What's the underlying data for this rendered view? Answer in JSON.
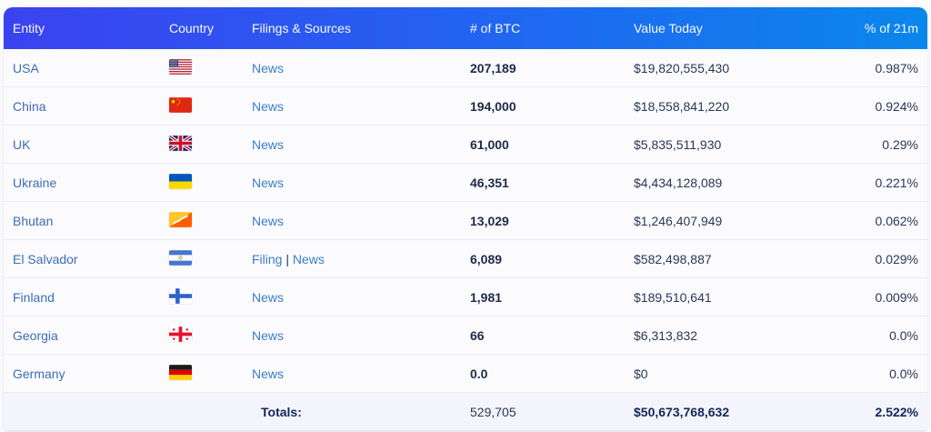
{
  "table": {
    "columns": [
      "Entity",
      "Country",
      "Filings & Sources",
      "# of BTC",
      "Value Today",
      "% of 21m"
    ],
    "rows": [
      {
        "entity": "USA",
        "flag": "usa",
        "sources": [
          "News"
        ],
        "btc": "207,189",
        "value": "$19,820,555,430",
        "pct": "0.987%"
      },
      {
        "entity": "China",
        "flag": "china",
        "sources": [
          "News"
        ],
        "btc": "194,000",
        "value": "$18,558,841,220",
        "pct": "0.924%"
      },
      {
        "entity": "UK",
        "flag": "uk",
        "sources": [
          "News"
        ],
        "btc": "61,000",
        "value": "$5,835,511,930",
        "pct": "0.29%"
      },
      {
        "entity": "Ukraine",
        "flag": "ukraine",
        "sources": [
          "News"
        ],
        "btc": "46,351",
        "value": "$4,434,128,089",
        "pct": "0.221%"
      },
      {
        "entity": "Bhutan",
        "flag": "bhutan",
        "sources": [
          "News"
        ],
        "btc": "13,029",
        "value": "$1,246,407,949",
        "pct": "0.062%"
      },
      {
        "entity": "El Salvador",
        "flag": "el-salvador",
        "sources": [
          "Filing",
          "News"
        ],
        "btc": "6,089",
        "value": "$582,498,887",
        "pct": "0.029%"
      },
      {
        "entity": "Finland",
        "flag": "finland",
        "sources": [
          "News"
        ],
        "btc": "1,981",
        "value": "$189,510,641",
        "pct": "0.009%"
      },
      {
        "entity": "Georgia",
        "flag": "georgia",
        "sources": [
          "News"
        ],
        "btc": "66",
        "value": "$6,313,832",
        "pct": "0.0%"
      },
      {
        "entity": "Germany",
        "flag": "germany",
        "sources": [
          "News"
        ],
        "btc": "0.0",
        "value": "$0",
        "pct": "0.0%"
      }
    ],
    "totals": {
      "label": "Totals:",
      "btc": "529,705",
      "value": "$50,673,768,632",
      "pct": "2.522%"
    }
  },
  "colors": {
    "header_gradient_start": "#3b42f0",
    "header_gradient_end": "#0a87ec",
    "entity_link": "#3d6cb4",
    "source_link": "#3b7cc9",
    "btc_text": "#1e2a48",
    "value_text": "#2b3753",
    "totals_text": "#12265a",
    "row_bg": "#fbfbfe",
    "totals_bg": "#f4f5fb",
    "row_border": "#e9ebf5"
  }
}
